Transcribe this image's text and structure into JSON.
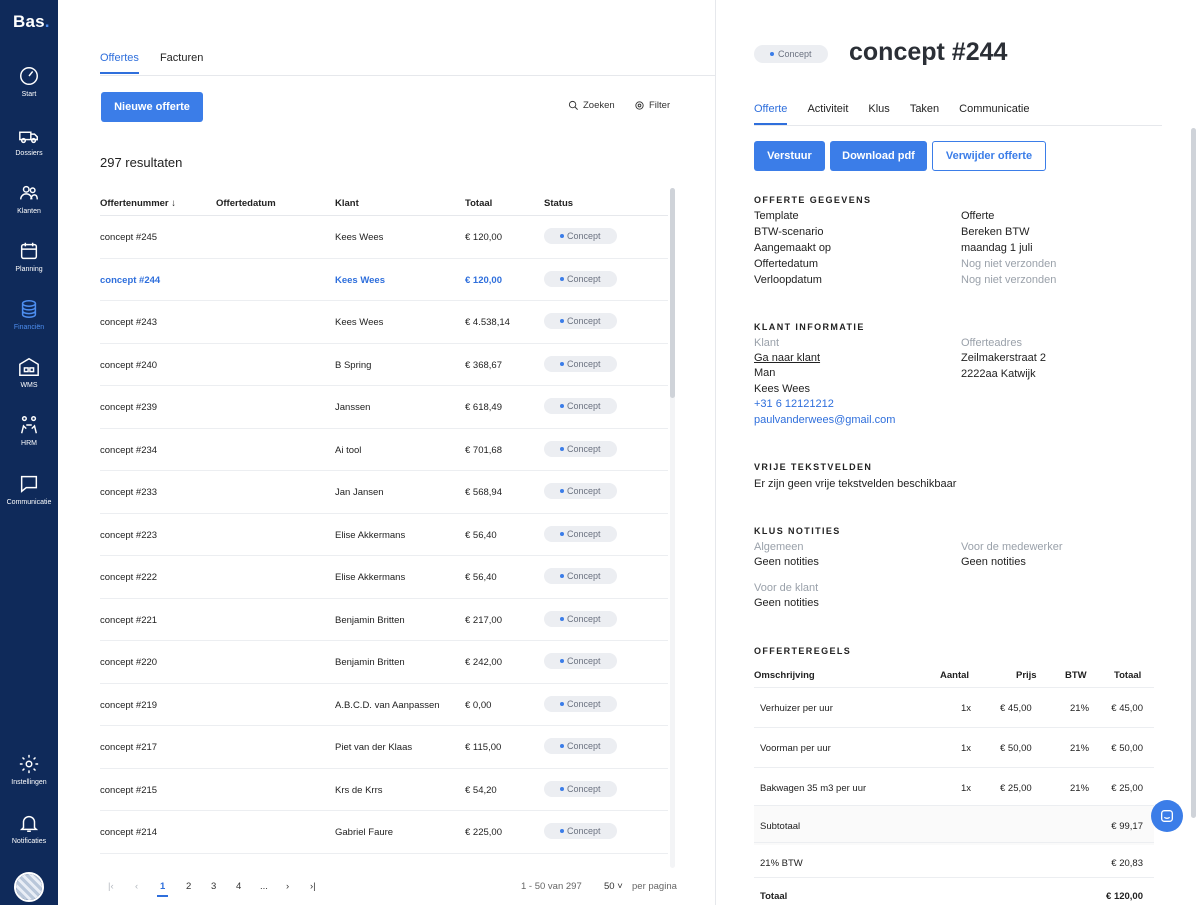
{
  "app": {
    "logo": "Bas",
    "logo_dot": "."
  },
  "sidebar": {
    "items": [
      {
        "label": "Start",
        "icon": "gauge-icon"
      },
      {
        "label": "Dossiers",
        "icon": "truck-icon"
      },
      {
        "label": "Klanten",
        "icon": "users-icon"
      },
      {
        "label": "Planning",
        "icon": "calendar-icon"
      },
      {
        "label": "Financiën",
        "icon": "coins-icon",
        "active": true
      },
      {
        "label": "WMS",
        "icon": "warehouse-icon"
      },
      {
        "label": "HRM",
        "icon": "people-icon"
      },
      {
        "label": "Communicatie",
        "icon": "chat-icon"
      },
      {
        "label": "Instellingen",
        "icon": "gear-icon"
      },
      {
        "label": "Notificaties",
        "icon": "bell-icon"
      }
    ]
  },
  "list": {
    "tabs": [
      "Offertes",
      "Facturen"
    ],
    "new_button": "Nieuwe offerte",
    "search": "Zoeken",
    "filter": "Filter",
    "results": "297 resultaten",
    "columns": [
      "Offertenummer",
      "Offertedatum",
      "Klant",
      "Totaal",
      "Status"
    ],
    "rows": [
      {
        "nr": "concept #245",
        "datum": "",
        "klant": "Kees Wees",
        "totaal": "€ 120,00",
        "status": "Concept"
      },
      {
        "nr": "concept #244",
        "datum": "",
        "klant": "Kees Wees",
        "totaal": "€ 120,00",
        "status": "Concept"
      },
      {
        "nr": "concept #243",
        "datum": "",
        "klant": "Kees Wees",
        "totaal": "€ 4.538,14",
        "status": "Concept"
      },
      {
        "nr": "concept #240",
        "datum": "",
        "klant": "B Spring",
        "totaal": "€ 368,67",
        "status": "Concept"
      },
      {
        "nr": "concept #239",
        "datum": "",
        "klant": "Janssen",
        "totaal": "€ 618,49",
        "status": "Concept"
      },
      {
        "nr": "concept #234",
        "datum": "",
        "klant": "Ai tool",
        "totaal": "€ 701,68",
        "status": "Concept"
      },
      {
        "nr": "concept #233",
        "datum": "",
        "klant": "Jan Jansen",
        "totaal": "€ 568,94",
        "status": "Concept"
      },
      {
        "nr": "concept #223",
        "datum": "",
        "klant": "Elise Akkermans",
        "totaal": "€ 56,40",
        "status": "Concept"
      },
      {
        "nr": "concept #222",
        "datum": "",
        "klant": "Elise Akkermans",
        "totaal": "€ 56,40",
        "status": "Concept"
      },
      {
        "nr": "concept #221",
        "datum": "",
        "klant": "Benjamin Britten",
        "totaal": "€ 217,00",
        "status": "Concept"
      },
      {
        "nr": "concept #220",
        "datum": "",
        "klant": "Benjamin Britten",
        "totaal": "€ 242,00",
        "status": "Concept"
      },
      {
        "nr": "concept #219",
        "datum": "",
        "klant": "A.B.C.D. van Aanpassen",
        "totaal": "€ 0,00",
        "status": "Concept"
      },
      {
        "nr": "concept #217",
        "datum": "",
        "klant": "Piet van der Klaas",
        "totaal": "€ 115,00",
        "status": "Concept"
      },
      {
        "nr": "concept #215",
        "datum": "",
        "klant": "Krs de Krrs",
        "totaal": "€ 54,20",
        "status": "Concept"
      },
      {
        "nr": "concept #214",
        "datum": "",
        "klant": "Gabriel Faure",
        "totaal": "€ 225,00",
        "status": "Concept"
      }
    ],
    "selected_index": 1,
    "pager": {
      "pages": [
        "1",
        "2",
        "3",
        "4",
        "..."
      ],
      "current": "1",
      "range": "1 - 50 van 297",
      "per_page": "50",
      "per_page_label": "per pagina"
    }
  },
  "detail": {
    "status": "Concept",
    "title": "concept #244",
    "tabs": [
      "Offerte",
      "Activiteit",
      "Klus",
      "Taken",
      "Communicatie"
    ],
    "buttons": {
      "send": "Verstuur",
      "download": "Download pdf",
      "delete": "Verwijder offerte"
    },
    "offerte_gegevens": {
      "heading": "OFFERTE GEGEVENS",
      "fields": [
        {
          "label": "Template",
          "value": "Offerte",
          "muted": false
        },
        {
          "label": "BTW-scenario",
          "value": "Bereken BTW",
          "muted": false
        },
        {
          "label": "Aangemaakt op",
          "value": "maandag 1 juli",
          "muted": false
        },
        {
          "label": "Offertedatum",
          "value": "Nog niet verzonden",
          "muted": true
        },
        {
          "label": "Verloopdatum",
          "value": "Nog niet verzonden",
          "muted": true
        }
      ]
    },
    "klant_informatie": {
      "heading": "KLANT INFORMATIE",
      "klant_label": "Klant",
      "goto": "Ga naar klant",
      "salutation": "Man",
      "name": "Kees Wees",
      "phone": "+31 6 12121212",
      "email": "paulvanderwees@gmail.com",
      "adres_label": "Offerteadres",
      "street": "Zeilmakerstraat 2",
      "city": "2222aa Katwijk"
    },
    "vrije_tekstvelden": {
      "heading": "VRIJE TEKSTVELDEN",
      "text": "Er zijn geen vrije tekstvelden beschikbaar"
    },
    "klus_notities": {
      "heading": "KLUS NOTITIES",
      "algemeen_label": "Algemeen",
      "algemeen_value": "Geen notities",
      "medewerker_label": "Voor de medewerker",
      "medewerker_value": "Geen notities",
      "klant_label": "Voor de klant",
      "klant_value": "Geen notities"
    },
    "offerteregels": {
      "heading": "OFFERTEREGELS",
      "columns": [
        "Omschrijving",
        "Aantal",
        "Prijs",
        "BTW",
        "Totaal"
      ],
      "lines": [
        {
          "desc": "Verhuizer per uur",
          "qty": "1x",
          "price": "€ 45,00",
          "btw": "21%",
          "total": "€ 45,00"
        },
        {
          "desc": "Voorman per uur",
          "qty": "1x",
          "price": "€ 50,00",
          "btw": "21%",
          "total": "€ 50,00"
        },
        {
          "desc": "Bakwagen 35 m3 per uur",
          "qty": "1x",
          "price": "€ 25,00",
          "btw": "21%",
          "total": "€ 25,00"
        }
      ],
      "subtotal_label": "Subtotaal",
      "subtotal": "€ 99,17",
      "btw_label": "21% BTW",
      "btw": "€ 20,83",
      "total_label": "Totaal",
      "total": "€ 120,00"
    }
  },
  "colors": {
    "sidebar": "#0f2a5a",
    "accent": "#3b7de8"
  }
}
